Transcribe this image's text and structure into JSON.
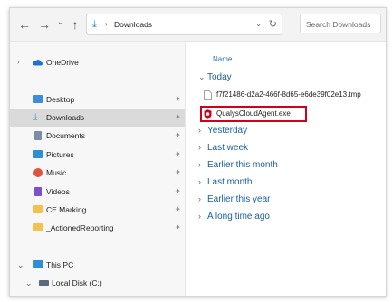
{
  "toolbar": {
    "back_glyph": "←",
    "forward_glyph": "→",
    "dropdown_glyph": "⌄",
    "up_glyph": "↑",
    "address_separator": "›",
    "address_crumb": "Downloads",
    "refresh_glyph": "↻",
    "search_placeholder": "Search Downloads"
  },
  "sidebar": {
    "items": [
      {
        "label": "OneDrive",
        "icon": "cloud-icon",
        "color": "#1a73d9",
        "expandable": true
      },
      {
        "label": "Desktop",
        "icon": "desktop-folder-icon",
        "color": "#3c8dde",
        "pinned": true
      },
      {
        "label": "Downloads",
        "icon": "download-icon",
        "color": "#2a8ad4",
        "pinned": true,
        "selected": true
      },
      {
        "label": "Documents",
        "icon": "documents-folder-icon",
        "color": "#7a8fa6",
        "pinned": true
      },
      {
        "label": "Pictures",
        "icon": "pictures-folder-icon",
        "color": "#2f8ed8",
        "pinned": true
      },
      {
        "label": "Music",
        "icon": "music-folder-icon",
        "color": "#e0533d",
        "pinned": true
      },
      {
        "label": "Videos",
        "icon": "videos-folder-icon",
        "color": "#7a52c7",
        "pinned": true
      },
      {
        "label": "CE Marking",
        "icon": "folder-icon",
        "color": "#f2c14e",
        "pinned": true
      },
      {
        "label": "_ActionedReporting",
        "icon": "folder-icon",
        "color": "#f2c14e",
        "pinned": true
      },
      {
        "label": "This PC",
        "icon": "monitor-icon",
        "color": "#2f8ed8",
        "expandable": true
      },
      {
        "label": "Local Disk (C:)",
        "icon": "drive-icon",
        "color": "#5a6b7d",
        "expandable": true
      }
    ],
    "pin_glyph": "📌",
    "chevron_right": "›",
    "chevron_down": "⌄"
  },
  "main": {
    "column_name": "Name",
    "groups": [
      {
        "label": "Today",
        "expanded": true
      },
      {
        "label": "Yesterday"
      },
      {
        "label": "Last week"
      },
      {
        "label": "Earlier this month"
      },
      {
        "label": "Last month"
      },
      {
        "label": "Earlier this year"
      },
      {
        "label": "A long time ago"
      }
    ],
    "files": [
      {
        "name": "f7f21486-d2a2-466f-8d65-e6de39f02e13.tmp",
        "icon": "file-icon"
      },
      {
        "name": "QualysCloudAgent.exe",
        "icon": "qualys-shield-icon",
        "highlighted": true
      }
    ],
    "highlight_color": "#d0021b",
    "group_chevron_right": "›",
    "group_chevron_down": "⌄"
  }
}
